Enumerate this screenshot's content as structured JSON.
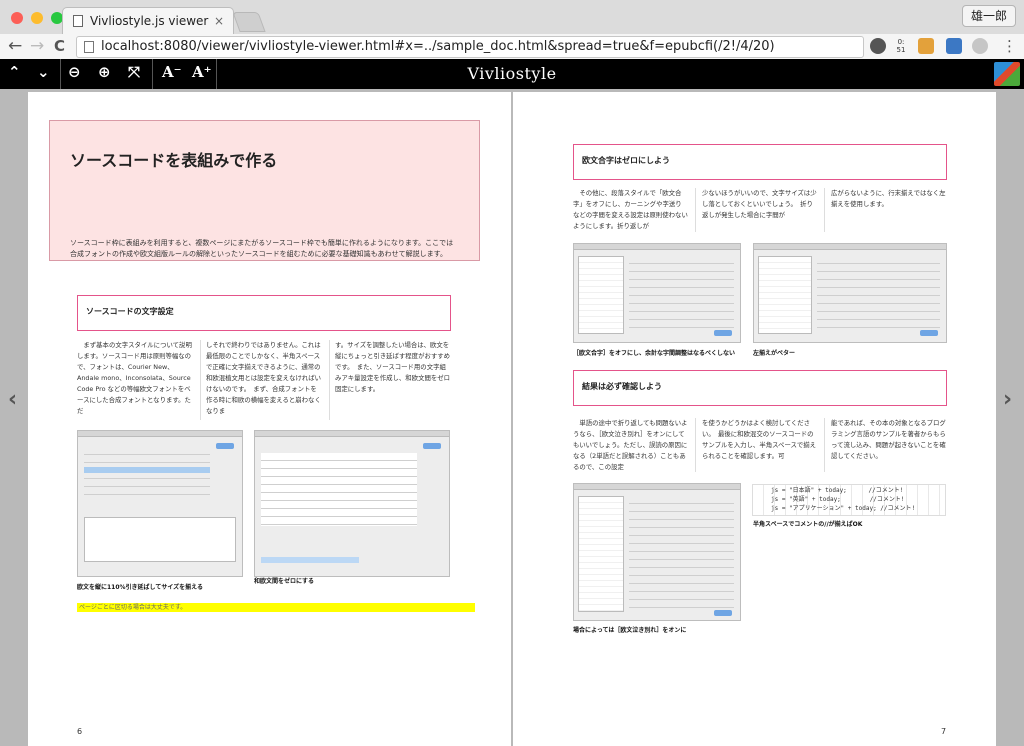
{
  "browser": {
    "tab_title": "Vivliostyle.js viewer",
    "tab_close": "×",
    "profile_name": "雄一郎",
    "url": "localhost:8080/viewer/vivliostyle-viewer.html#x=../sample_doc.html&spread=true&f=epubcfi(/2!/4/20)",
    "ext_counter": "0: 51",
    "nav": {
      "back": "←",
      "forward": "→",
      "reload": "C",
      "star": "☆",
      "menu": "⋮"
    }
  },
  "viewer_bar": {
    "brand": "Vivliostyle",
    "buttons": {
      "prev": "⌃",
      "next": "⌄",
      "zoom_out": "⊖",
      "zoom_in": "⊕",
      "fit": "⤧",
      "font_smaller": "A⁻",
      "font_larger": "A⁺"
    }
  },
  "page_left": {
    "title": "ソースコードを表組みで作る",
    "intro": "ソースコード枠に表組みを利用すると、複数ページにまたがるソースコード枠でも簡単に作れるようになります。ここでは合成フォントの作成や欧文組版ルールの解除といったソースコードを組むために必要な基礎知識もあわせて解説します。",
    "section_heading": "ソースコードの文字設定",
    "col1": "まず基本の文字スタイルについて説明します。ソースコード用は原則等幅なので、フォントは、Courier New、Andale mono、Inconsolata、Source Code Pro などの等幅欧文フォントをベースにした合成フォントとなります。ただ",
    "col2": "しそれで終わりではありません。これは最低限のことでしかなく、半角スペースで正確に文字揃えできるように、通常の和欧混植文用とは設定を変えなければいけないのです。　まず、合成フォントを作る時に和欧の横幅を変えると崩わなくなりま",
    "col3": "す。サイズを調整したい場合は、欧文を縦にちょっと引き延ばす程度がおすすめです。　また、ソースコード用の文字組みアキ量設定を作成し、和欧文間をゼロ固定にします。",
    "caption1": "欧文を縦に110%引き延ばしてサイズを揃える",
    "caption2": "和欧文間をゼロにする",
    "highlight": "ページごとに区切る場合は大丈夫です。",
    "page_number": "6"
  },
  "page_right": {
    "section1_heading": "欧文合字はゼロにしよう",
    "s1_col1": "その他に、段落スタイルで「欧文合字」をオフにし、カーニングや字送りなどの字間を変える設定は原則使わないようにします。折り返しが",
    "s1_col2": "少ないほうがいいので、文字サイズは少し落としておくといいでしょう。　折り返しが発生した場合に字間が",
    "s1_col3": "広がらないように、行末揃えではなく左揃えを使用します。",
    "caption1": "［欧文合字］をオフにし、余計な字間調整はなるべくしない",
    "caption2": "左揃えがベター",
    "section2_heading": "結果は必ず確認しよう",
    "s2_col1": "単語の途中で折り返しても問題ないようなら、［欧文泣き別れ］をオンにしてもいいでしょう。ただし、誤読の原因になる（2単語だと誤解される）こともあるので、この設定",
    "s2_col2": "を使うかどうかはよく検討してください。　最後に和欧混交のソースコードのサンプルを入力し、半角スペースで揃えられることを確認します。可",
    "s2_col3": "能であれば、その本の対象となるプログラミング言語のサンプルを著者からもらって流し込み、問題が起きないことを確認してください。",
    "code_sample": "js = \"日本語\" + today;      //コメント!\njs = \"英語\" + today;        //コメント!\njs = \"アプリケーション\" + today; //コメント!",
    "caption3": "場合によっては［欧文泣き別れ］をオンに",
    "caption4": "半角スペースでコメントの//が揃えばOK",
    "page_number": "7"
  },
  "spread_nav": {
    "prev": "‹",
    "next": "›"
  }
}
